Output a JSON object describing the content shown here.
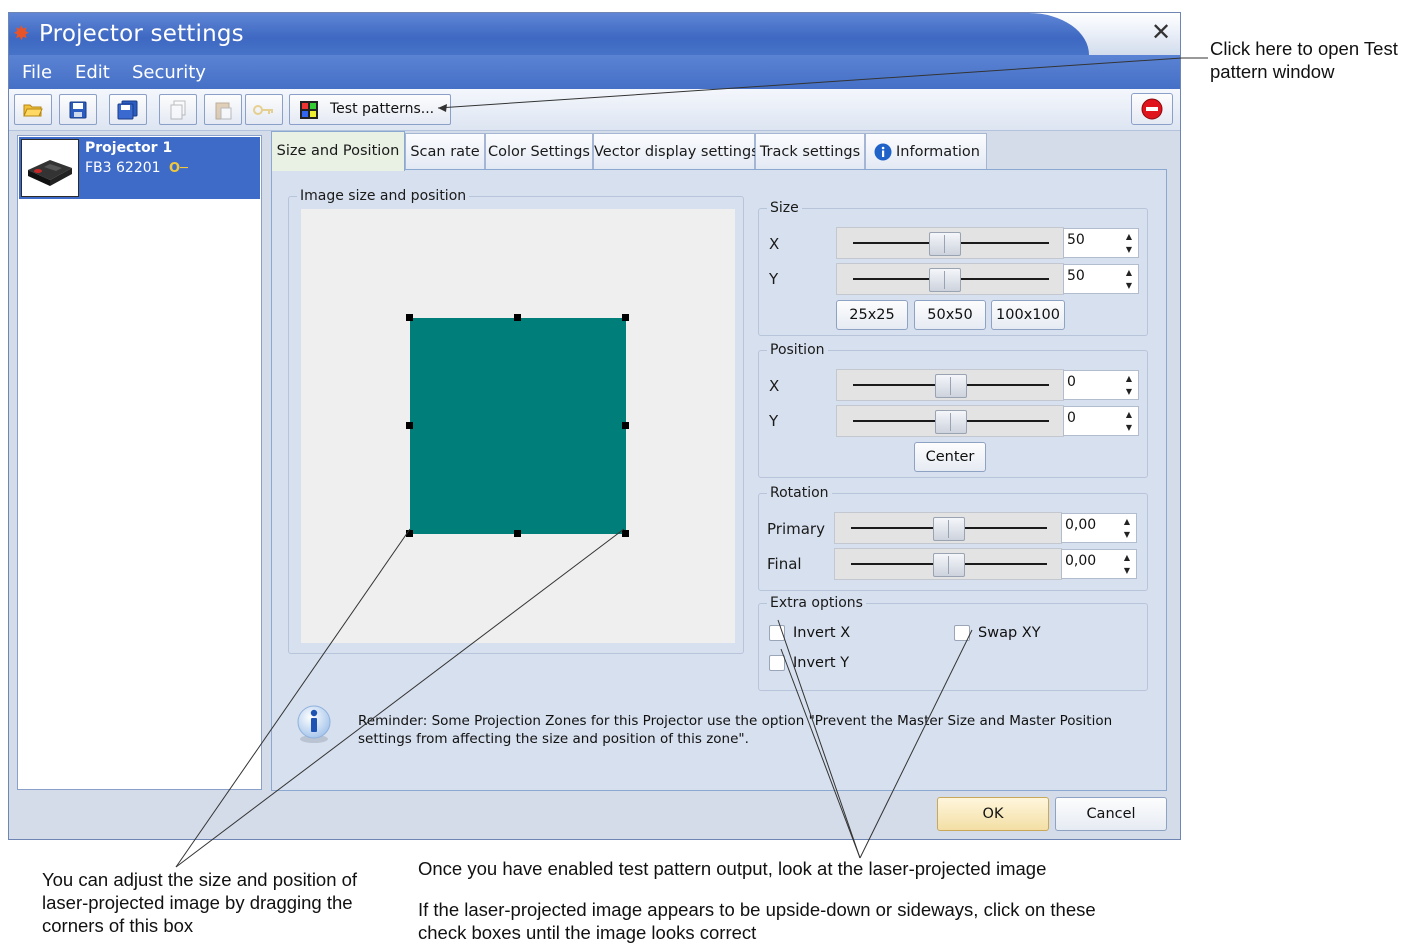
{
  "window": {
    "title": "Projector settings",
    "close_glyph": "✕",
    "app_icon": "starburst-icon"
  },
  "menu": [
    {
      "label": "File"
    },
    {
      "label": "Edit"
    },
    {
      "label": "Security"
    }
  ],
  "toolbar": {
    "buttons": [
      {
        "icon": "open-folder-icon",
        "enabled": true
      },
      {
        "icon": "save-icon",
        "enabled": true
      },
      {
        "icon": "save-all-icon",
        "enabled": true
      },
      {
        "icon": "copy-icon",
        "enabled": false
      },
      {
        "icon": "paste-icon",
        "enabled": false
      },
      {
        "icon": "key-icon",
        "enabled": false
      }
    ],
    "test_patterns_label": "Test patterns...",
    "stop_icon": "stop-icon"
  },
  "projector_list": [
    {
      "name": "Projector 1",
      "serial": "FB3 62201",
      "key_glyph": "O─",
      "selected": true
    }
  ],
  "tabs": [
    {
      "label": "Size and Position",
      "active": true
    },
    {
      "label": "Scan rate",
      "active": false
    },
    {
      "label": "Color Settings",
      "active": false
    },
    {
      "label": "Vector display settings",
      "active": false
    },
    {
      "label": "Track settings",
      "active": false
    },
    {
      "label": "Information",
      "active": false,
      "icon": "info-icon"
    }
  ],
  "image_group": {
    "label": "Image size and position",
    "preview_color": "#007f7a"
  },
  "size": {
    "label": "Size",
    "x_label": "X",
    "y_label": "Y",
    "x_value": "50",
    "y_value": "50",
    "presets": [
      "25x25",
      "50x50",
      "100x100"
    ]
  },
  "position": {
    "label": "Position",
    "x_label": "X",
    "y_label": "Y",
    "x_value": "0",
    "y_value": "0",
    "center_label": "Center"
  },
  "rotation": {
    "label": "Rotation",
    "primary_label": "Primary",
    "final_label": "Final",
    "primary_value": "0,00",
    "final_value": "0,00"
  },
  "extra_options": {
    "label": "Extra options",
    "invert_x": "Invert X",
    "invert_y": "Invert Y",
    "swap_xy": "Swap XY"
  },
  "reminder": "Reminder: Some Projection Zones for this Projector use the option \"Prevent the Master Size and Master Position settings from affecting the size and position of this zone\".",
  "buttons": {
    "ok": "OK",
    "cancel": "Cancel"
  },
  "callouts": {
    "test_pattern": "Click here to open Test pattern window",
    "resize": "You can adjust the size and position of laser-projected image by dragging the corners of this box",
    "look": "Once you have enabled test pattern output, look at the laser-projected image",
    "checkboxes": "If the laser-projected image appears to be upside-down or sideways, click on these check boxes until the image looks correct"
  },
  "colors": {
    "title_blue": "#4673c8",
    "selection_blue": "#3f6bc8",
    "preview_teal": "#007f7a",
    "stop_red": "#e0141c"
  }
}
